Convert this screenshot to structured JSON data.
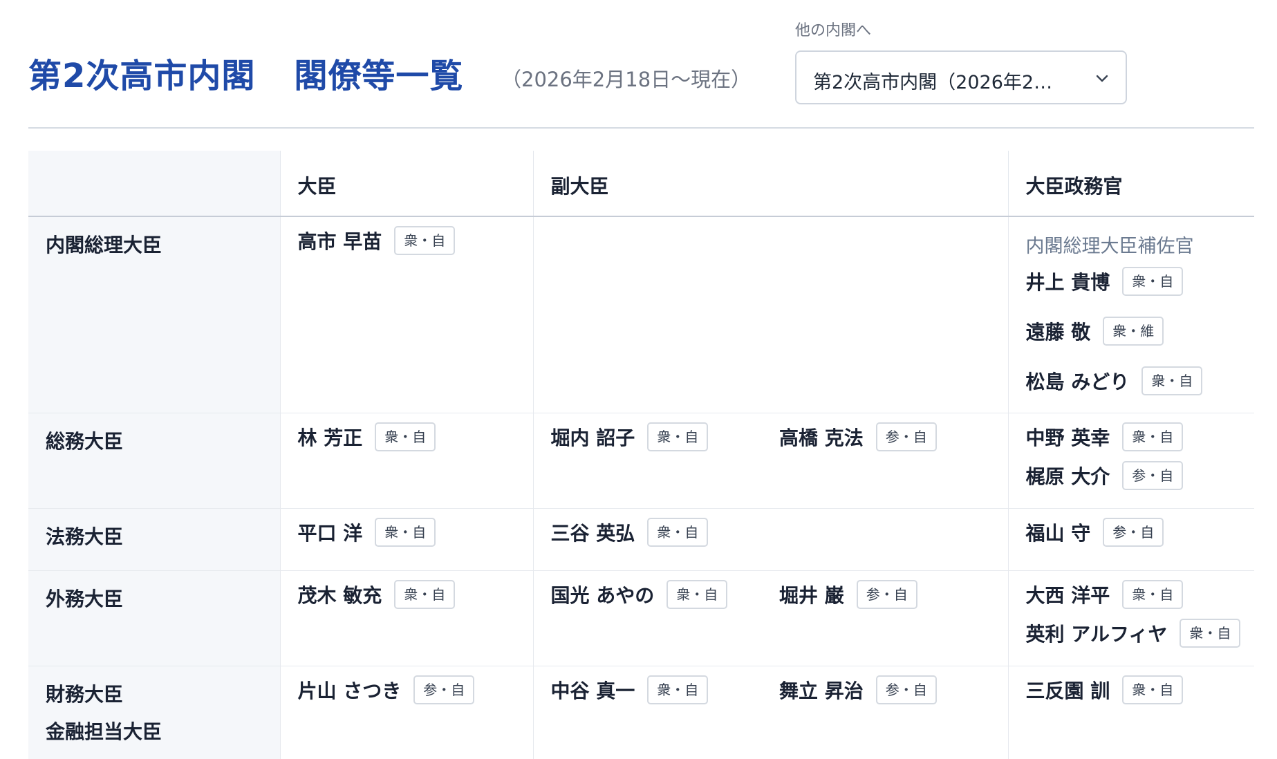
{
  "header": {
    "title_part1": "第2次高市内閣",
    "title_part2": "閣僚等一覧",
    "period": "（2026年2月18日～現在）",
    "other_label": "他の内閣へ",
    "select_value": "第2次高市内閣（2026年2…"
  },
  "table": {
    "columns": [
      "",
      "大臣",
      "副大臣",
      "大臣政務官"
    ],
    "rows": [
      {
        "ministry": [
          "内閣総理大臣"
        ],
        "minister": [
          {
            "name": "高市 早苗",
            "badge": "衆・自"
          }
        ],
        "vice": [],
        "parl_label": "内閣総理大臣補佐官",
        "parl": [
          {
            "name": "井上 貴博",
            "badge": "衆・自"
          },
          {
            "name": "遠藤 敬",
            "badge": "衆・維"
          },
          {
            "name": "松島 みどり",
            "badge": "衆・自"
          }
        ]
      },
      {
        "ministry": [
          "総務大臣"
        ],
        "minister": [
          {
            "name": "林 芳正",
            "badge": "衆・自"
          }
        ],
        "vice": [
          {
            "name": "堀内 詔子",
            "badge": "衆・自"
          },
          {
            "name": "高橋 克法",
            "badge": "参・自"
          }
        ],
        "parl": [
          {
            "name": "中野 英幸",
            "badge": "衆・自"
          },
          {
            "name": "梶原 大介",
            "badge": "参・自"
          }
        ]
      },
      {
        "ministry": [
          "法務大臣"
        ],
        "minister": [
          {
            "name": "平口 洋",
            "badge": "衆・自"
          }
        ],
        "vice": [
          {
            "name": "三谷 英弘",
            "badge": "衆・自"
          }
        ],
        "parl": [
          {
            "name": "福山 守",
            "badge": "参・自"
          }
        ]
      },
      {
        "ministry": [
          "外務大臣"
        ],
        "minister": [
          {
            "name": "茂木 敏充",
            "badge": "衆・自"
          }
        ],
        "vice": [
          {
            "name": "国光 あやの",
            "badge": "衆・自"
          },
          {
            "name": "堀井 巌",
            "badge": "参・自"
          }
        ],
        "parl": [
          {
            "name": "大西 洋平",
            "badge": "衆・自"
          },
          {
            "name": "英利 アルフィヤ",
            "badge": "衆・自"
          }
        ]
      },
      {
        "ministry": [
          "財務大臣",
          "金融担当大臣"
        ],
        "minister": [
          {
            "name": "片山 さつき",
            "badge": "参・自"
          }
        ],
        "vice": [
          {
            "name": "中谷 真一",
            "badge": "衆・自"
          },
          {
            "name": "舞立 昇治",
            "badge": "参・自"
          }
        ],
        "parl": [
          {
            "name": "三反園 訓",
            "badge": "衆・自"
          }
        ]
      }
    ]
  }
}
